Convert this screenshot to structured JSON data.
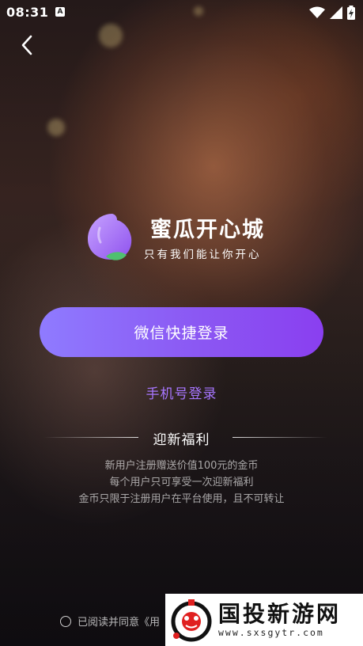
{
  "status_bar": {
    "time": "08:31",
    "notification_icon": "A"
  },
  "brand": {
    "title": "蜜瓜开心城",
    "slogan": "只有我们能让你开心",
    "logo_icon": "peach-icon",
    "logo_color": "#a36ef0"
  },
  "login": {
    "wechat_button_label": "微信快捷登录",
    "phone_login_label": "手机号登录",
    "accent_color": "#8b58f3"
  },
  "welfare": {
    "title": "迎新福利",
    "lines": [
      "新用户注册赠送价值100元的金币",
      "每个用户只可享受一次迎新福利",
      "金币只限于注册用户在平台使用，且不可转让"
    ]
  },
  "agreement": {
    "text": "已阅读并同意《用"
  },
  "watermark": {
    "name": "国投新游网",
    "url": "www.sxsgytr.com"
  }
}
